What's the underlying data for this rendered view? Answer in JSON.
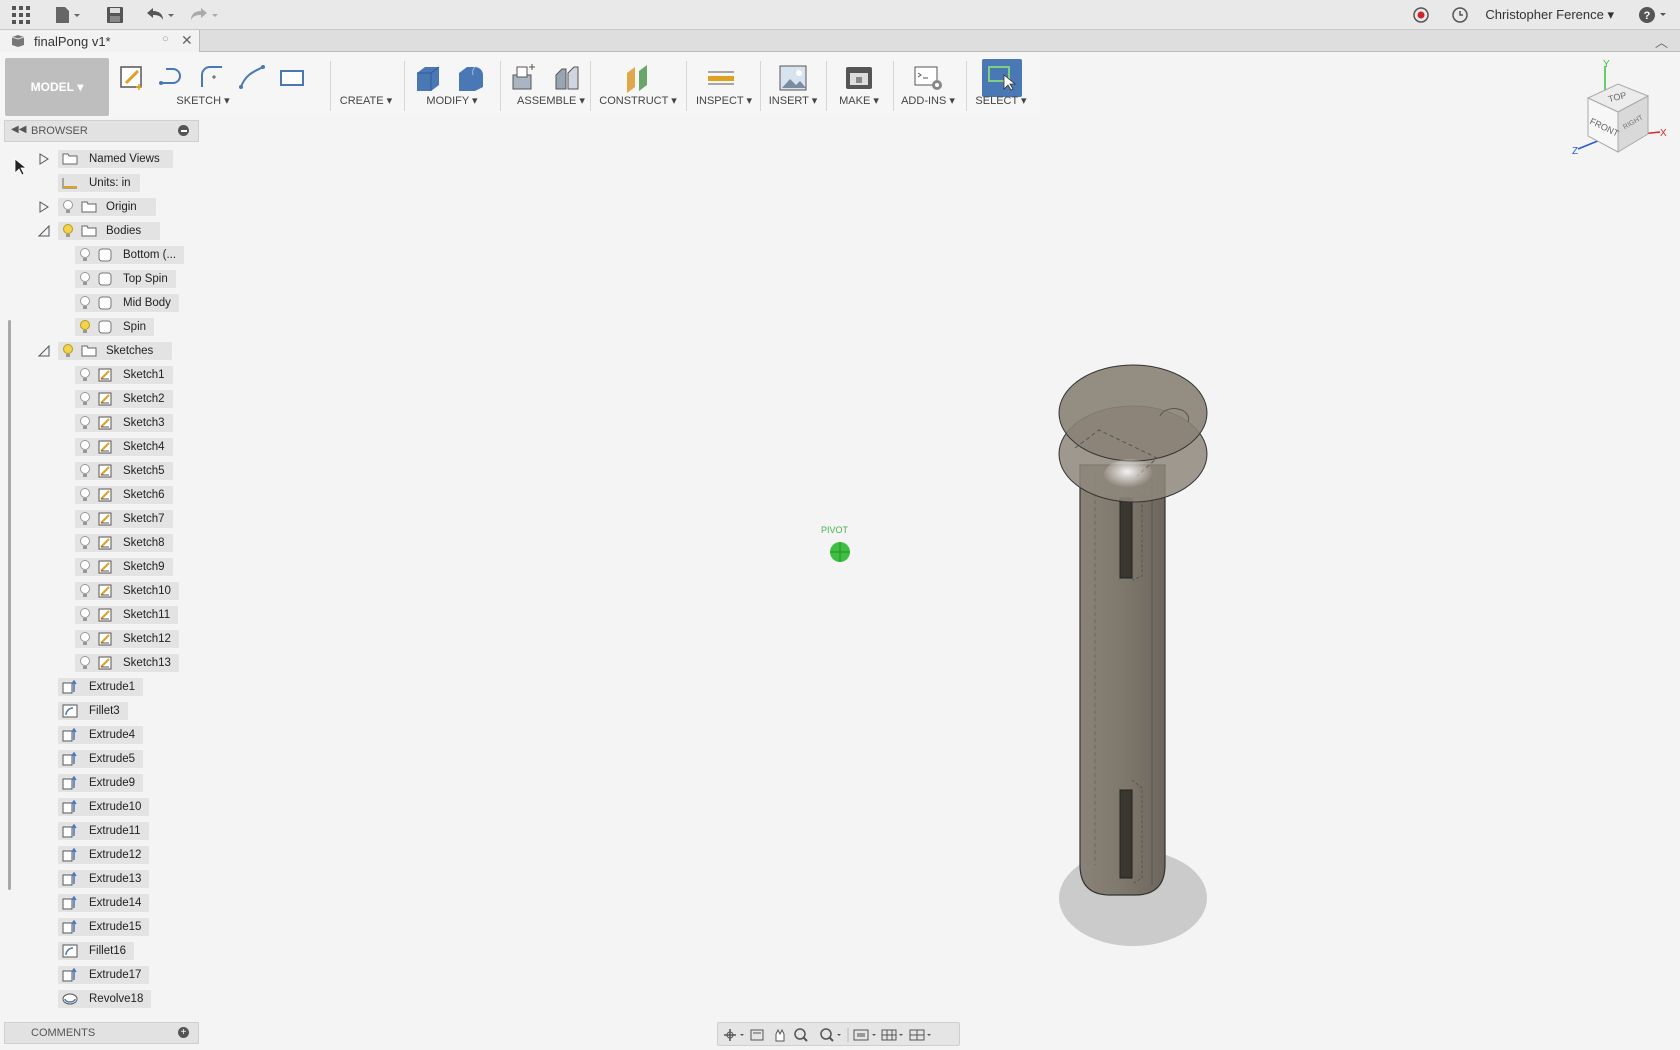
{
  "app": {
    "user_name": "Christopher Ference",
    "document_tab": "finalPong v1*"
  },
  "toolbar": {
    "workspace": "MODEL",
    "groups": [
      "SKETCH",
      "CREATE",
      "MODIFY",
      "ASSEMBLE",
      "CONSTRUCT",
      "INSPECT",
      "INSERT",
      "MAKE",
      "ADD-INS",
      "SELECT"
    ]
  },
  "browser": {
    "title": "BROWSER",
    "named_views": "Named Views",
    "units": "Units: in",
    "origin": "Origin",
    "bodies": "Bodies",
    "body_items": [
      "Bottom (...",
      "Top Spin",
      "Mid Body",
      "Spin"
    ],
    "sketches": "Sketches",
    "sketch_items": [
      "Sketch1",
      "Sketch2",
      "Sketch3",
      "Sketch4",
      "Sketch5",
      "Sketch6",
      "Sketch7",
      "Sketch8",
      "Sketch9",
      "Sketch10",
      "Sketch11",
      "Sketch12",
      "Sketch13"
    ],
    "features": [
      "Extrude1",
      "Fillet3",
      "Extrude4",
      "Extrude5",
      "Extrude9",
      "Extrude10",
      "Extrude11",
      "Extrude12",
      "Extrude13",
      "Extrude14",
      "Extrude15",
      "Fillet16",
      "Extrude17",
      "Revolve18"
    ]
  },
  "comments": {
    "title": "COMMENTS"
  },
  "viewport": {
    "pivot_label": "PIVOT",
    "viewcube": {
      "top": "TOP",
      "front": "FRONT",
      "right": "RIGHT",
      "axis_x": "X",
      "axis_y": "Y",
      "axis_z": "Z"
    }
  },
  "colors": {
    "selected_tool": "#4a78b5",
    "pivot": "#3fbf3f",
    "body": "#8a8276"
  }
}
